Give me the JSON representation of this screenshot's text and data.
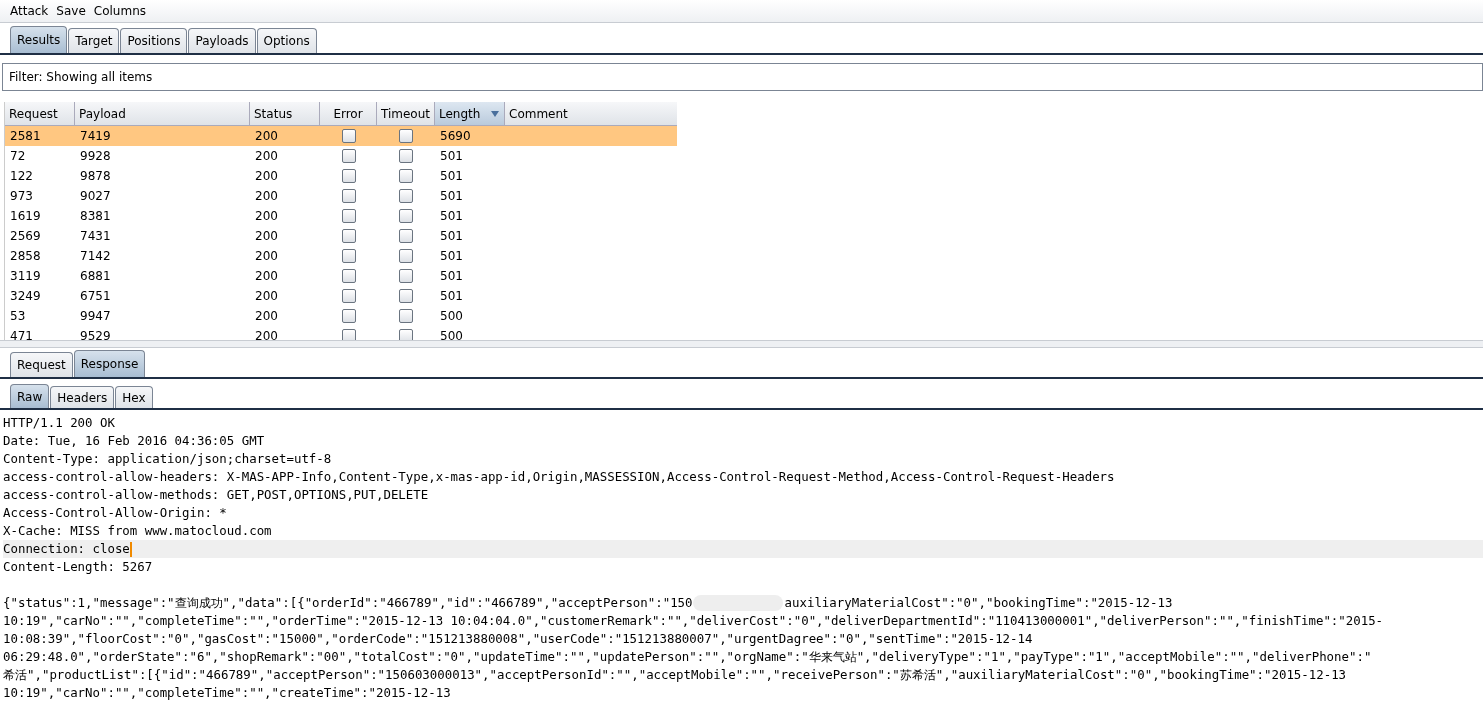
{
  "menu": [
    "Attack",
    "Save",
    "Columns"
  ],
  "tabs": [
    {
      "label": "Results",
      "selected": true
    },
    {
      "label": "Target",
      "selected": false
    },
    {
      "label": "Positions",
      "selected": false
    },
    {
      "label": "Payloads",
      "selected": false
    },
    {
      "label": "Options",
      "selected": false
    }
  ],
  "filter": "Filter: Showing all items",
  "table": {
    "columns": [
      {
        "label": "Request",
        "sorted": false
      },
      {
        "label": "Payload",
        "sorted": false
      },
      {
        "label": "Status",
        "sorted": false
      },
      {
        "label": "Error",
        "sorted": false
      },
      {
        "label": "Timeout",
        "sorted": false
      },
      {
        "label": "Length",
        "sorted": true
      },
      {
        "label": "Comment",
        "sorted": false
      }
    ],
    "rows": [
      {
        "request": "2581",
        "payload": "7419",
        "status": "200",
        "error": false,
        "timeout": false,
        "length": "5690",
        "selected": true
      },
      {
        "request": "72",
        "payload": "9928",
        "status": "200",
        "error": false,
        "timeout": false,
        "length": "501",
        "selected": false
      },
      {
        "request": "122",
        "payload": "9878",
        "status": "200",
        "error": false,
        "timeout": false,
        "length": "501",
        "selected": false
      },
      {
        "request": "973",
        "payload": "9027",
        "status": "200",
        "error": false,
        "timeout": false,
        "length": "501",
        "selected": false
      },
      {
        "request": "1619",
        "payload": "8381",
        "status": "200",
        "error": false,
        "timeout": false,
        "length": "501",
        "selected": false
      },
      {
        "request": "2569",
        "payload": "7431",
        "status": "200",
        "error": false,
        "timeout": false,
        "length": "501",
        "selected": false
      },
      {
        "request": "2858",
        "payload": "7142",
        "status": "200",
        "error": false,
        "timeout": false,
        "length": "501",
        "selected": false
      },
      {
        "request": "3119",
        "payload": "6881",
        "status": "200",
        "error": false,
        "timeout": false,
        "length": "501",
        "selected": false
      },
      {
        "request": "3249",
        "payload": "6751",
        "status": "200",
        "error": false,
        "timeout": false,
        "length": "501",
        "selected": false
      },
      {
        "request": "53",
        "payload": "9947",
        "status": "200",
        "error": false,
        "timeout": false,
        "length": "500",
        "selected": false
      },
      {
        "request": "471",
        "payload": "9529",
        "status": "200",
        "error": false,
        "timeout": false,
        "length": "500",
        "selected": false
      }
    ]
  },
  "message_tabs": [
    {
      "label": "Request",
      "selected": false
    },
    {
      "label": "Response",
      "selected": true
    }
  ],
  "view_tabs": [
    {
      "label": "Raw",
      "selected": true
    },
    {
      "label": "Headers",
      "selected": false
    },
    {
      "label": "Hex",
      "selected": false
    }
  ],
  "response_lines": [
    {
      "text": "HTTP/1.1 200 OK",
      "highlighted": false
    },
    {
      "text": "Date: Tue, 16 Feb 2016 04:36:05 GMT",
      "highlighted": false
    },
    {
      "text": "Content-Type: application/json;charset=utf-8",
      "highlighted": false
    },
    {
      "text": "access-control-allow-headers: X-MAS-APP-Info,Content-Type,x-mas-app-id,Origin,MASSESSION,Access-Control-Request-Method,Access-Control-Request-Headers",
      "highlighted": false
    },
    {
      "text": "access-control-allow-methods: GET,POST,OPTIONS,PUT,DELETE",
      "highlighted": false
    },
    {
      "text": "Access-Control-Allow-Origin: *",
      "highlighted": false
    },
    {
      "text": "X-Cache: MISS from www.matocloud.com",
      "highlighted": false
    },
    {
      "text": "Connection: close",
      "highlighted": true
    },
    {
      "text": "Content-Length: 5267",
      "highlighted": false
    },
    {
      "highlighted": false
    },
    {
      "text": "{\"status\":1,\"message\":\"查询成功\",\"data\":[{\"orderId\":\"466789\",\"id\":\"466789\",\"acceptPerson\":\"150",
      "after_redaction": "auxiliaryMaterialCost\":\"0\",\"bookingTime\":\"2015-12-13",
      "highlighted": false
    },
    {
      "text": "10:19\",\"carNo\":\"\",\"completeTime\":\"\",\"orderTime\":\"2015-12-13 10:04:04.0\",\"customerRemark\":\"\",\"deliverCost\":\"0\",\"deliverDepartmentId\":\"110413000001\",\"deliverPerson\":\"\",\"finishTime\":\"2015-",
      "highlighted": false
    },
    {
      "text": "10:08:39\",\"floorCost\":\"0\",\"gasCost\":\"15000\",\"orderCode\":\"151213880008\",\"userCode\":\"151213880007\",\"urgentDagree\":\"0\",\"sentTime\":\"2015-12-14",
      "highlighted": false
    },
    {
      "text": "06:29:48.0\",\"orderState\":\"6\",\"shopRemark\":\"00\",\"totalCost\":\"0\",\"updateTime\":\"\",\"updatePerson\":\"\",\"orgName\":\"华来气站\",\"deliveryType\":\"1\",\"payType\":\"1\",\"acceptMobile\":\"\",\"deliverPhone\":\"",
      "highlighted": false
    },
    {
      "text": "希活\",\"productList\":[{\"id\":\"466789\",\"acceptPerson\":\"150603000013\",\"acceptPersonId\":\"\",\"acceptMobile\":\"\",\"receivePerson\":\"苏希活\",\"auxiliaryMaterialCost\":\"0\",\"bookingTime\":\"2015-12-13",
      "highlighted": false
    },
    {
      "text": "10:19\",\"carNo\":\"\",\"completeTime\":\"\",\"createTime\":\"2015-12-13",
      "highlighted": false
    }
  ]
}
